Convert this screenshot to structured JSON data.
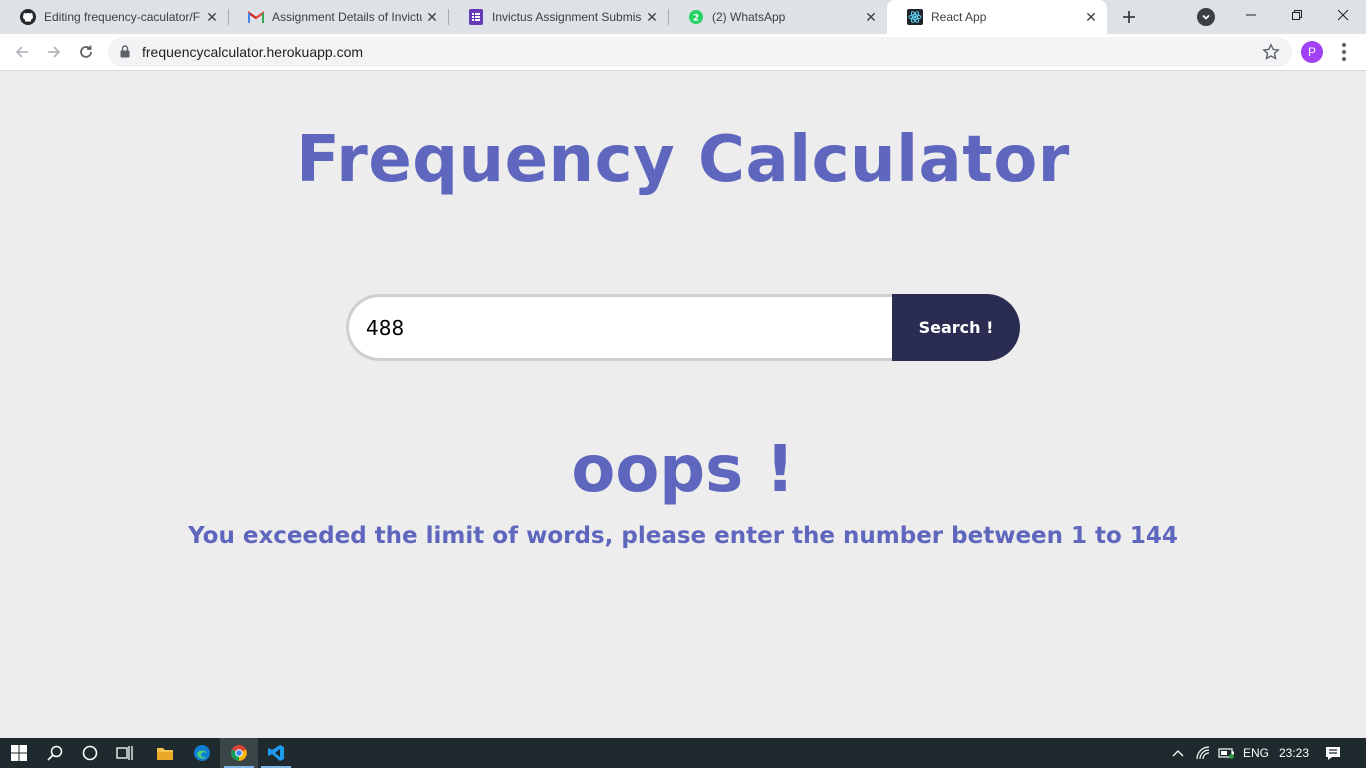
{
  "browser": {
    "tabs": [
      {
        "title": "Editing frequency-caculator/F",
        "icon": "github-icon"
      },
      {
        "title": "Assignment Details of Invictu",
        "icon": "gmail-icon"
      },
      {
        "title": "Invictus Assignment Submissi",
        "icon": "google-forms-icon"
      },
      {
        "title": "(2) WhatsApp",
        "icon": "whatsapp-icon",
        "badge": "2"
      },
      {
        "title": "React App",
        "icon": "react-icon",
        "active": true
      }
    ],
    "url": "frequencycalculator.herokuapp.com",
    "profile_initial": "P"
  },
  "page": {
    "title": "Frequency Calculator",
    "search_value": "488",
    "search_button": "Search !",
    "error_heading": "oops !",
    "error_message": "You exceeded the limit of words, please enter the number between 1 to 144"
  },
  "taskbar": {
    "language": "ENG",
    "time": "23:23"
  },
  "colors": {
    "accent": "#5f66bd",
    "button": "#2a2c52",
    "background": "#ededed"
  }
}
